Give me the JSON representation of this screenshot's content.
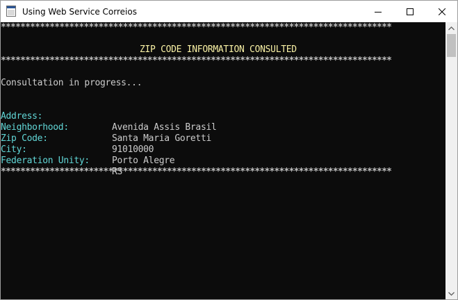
{
  "window": {
    "title": "Using Web Service Correios"
  },
  "console": {
    "separator": "********************************************************************************",
    "heading": "ZIP CODE INFORMATION CONSULTED",
    "status": "Consultation in progress...",
    "fields": [
      {
        "label": "Address:",
        "value": "Avenida Assis Brasil"
      },
      {
        "label": "Neighborhood:",
        "value": "Santa Maria Goretti"
      },
      {
        "label": "Zip Code:",
        "value": "91010000"
      },
      {
        "label": "City:",
        "value": "Porto Alegre"
      },
      {
        "label": "Federation Unity:",
        "value": "RS"
      }
    ]
  },
  "colors": {
    "background": "#0c0c0c",
    "heading": "#f9f1a5",
    "label": "#61d6d6",
    "text": "#cccccc"
  },
  "icons": {
    "app": "console-app-icon",
    "minimize": "minimize-icon",
    "maximize": "maximize-icon",
    "close": "close-icon",
    "scroll_up": "scroll-up-arrow-icon",
    "scroll_down": "scroll-down-arrow-icon"
  }
}
